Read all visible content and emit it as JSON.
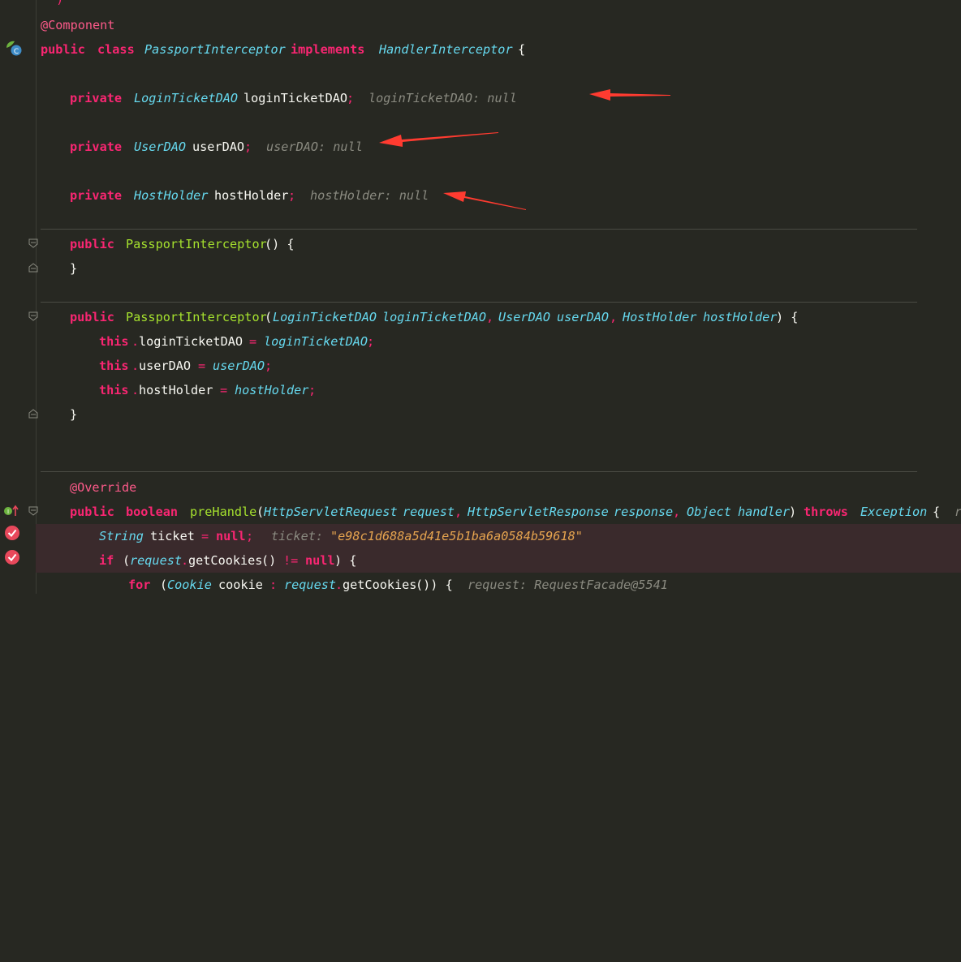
{
  "top_fragment": "*)",
  "lines": {
    "l1": {
      "annotation": "@Component"
    },
    "l2": {
      "kw1": "public",
      "kw2": "class",
      "class_name": "PassportInterceptor",
      "kw3": "implements",
      "iface": "HandlerInterceptor",
      "brace": "{"
    },
    "l3": {
      "kw": "private",
      "type": "LoginTicketDAO",
      "name": "loginTicketDAO",
      "semi": ";",
      "hint": "loginTicketDAO: null"
    },
    "l4": {
      "kw": "private",
      "type": "UserDAO",
      "name": "userDAO",
      "semi": ";",
      "hint": "userDAO: null"
    },
    "l5": {
      "kw": "private",
      "type": "HostHolder",
      "name": "hostHolder",
      "semi": ";",
      "hint": "hostHolder: null"
    },
    "l6": {
      "kw": "public",
      "fn": "PassportInterceptor",
      "rest": "() {"
    },
    "l7": {
      "brace": "}"
    },
    "l8": {
      "kw": "public",
      "fn": "PassportInterceptor",
      "open": "(",
      "t1": "LoginTicketDAO",
      "p1": "loginTicketDAO",
      "c1": ",",
      "t2": "UserDAO",
      "p2": "userDAO",
      "c2": ",",
      "t3": "HostHolder",
      "p3": "hostHolder",
      "close": ") {"
    },
    "l9": {
      "this": "this",
      "dot": ".",
      "field": "loginTicketDAO",
      "eq": "=",
      "val": "loginTicketDAO",
      "semi": ";"
    },
    "l10": {
      "this": "this",
      "dot": ".",
      "field": "userDAO",
      "eq": "=",
      "val": "userDAO",
      "semi": ";"
    },
    "l11": {
      "this": "this",
      "dot": ".",
      "field": "hostHolder",
      "eq": "=",
      "val": "hostHolder",
      "semi": ";"
    },
    "l12": {
      "brace": "}"
    },
    "l13": {
      "annotation": "@Override"
    },
    "l14": {
      "kw1": "public",
      "kw2": "boolean",
      "fn": "preHandle",
      "open": "(",
      "t1": "HttpServletRequest",
      "p1": "request",
      "c1": ",",
      "t2": "HttpServletResponse",
      "p2": "response",
      "c2": ",",
      "t3": "Object",
      "p3": "handler",
      "close": ")",
      "throws": "throws",
      "exc": "Exception",
      "brace": "{",
      "trail": "r"
    },
    "l15": {
      "type": "String",
      "name": "ticket",
      "eq": "=",
      "null": "null",
      "semi": ";",
      "hint_label": "ticket:",
      "hint_value": "\"e98c1d688a5d41e5b1ba6a0584b59618\""
    },
    "l16": {
      "kw": "if",
      "open": "(",
      "obj": "request",
      "dot": ".",
      "call": "getCookies",
      "args": "()",
      "neq": "!=",
      "null": "null",
      "close": ") {"
    },
    "l17": {
      "kw": "for",
      "open": "(",
      "type": "Cookie",
      "name": "cookie",
      "colon": ":",
      "obj": "request",
      "dot": ".",
      "call": "getCookies",
      "close": "()) {",
      "hint": "request: RequestFacade@5541"
    }
  },
  "colors": {
    "background": "#272822",
    "keyword": "#f92672",
    "type": "#66d9ef",
    "function": "#a6e22e",
    "hint": "#8a8a80",
    "arrow": "#ff3b30",
    "breakpoint": "#e8485b"
  }
}
